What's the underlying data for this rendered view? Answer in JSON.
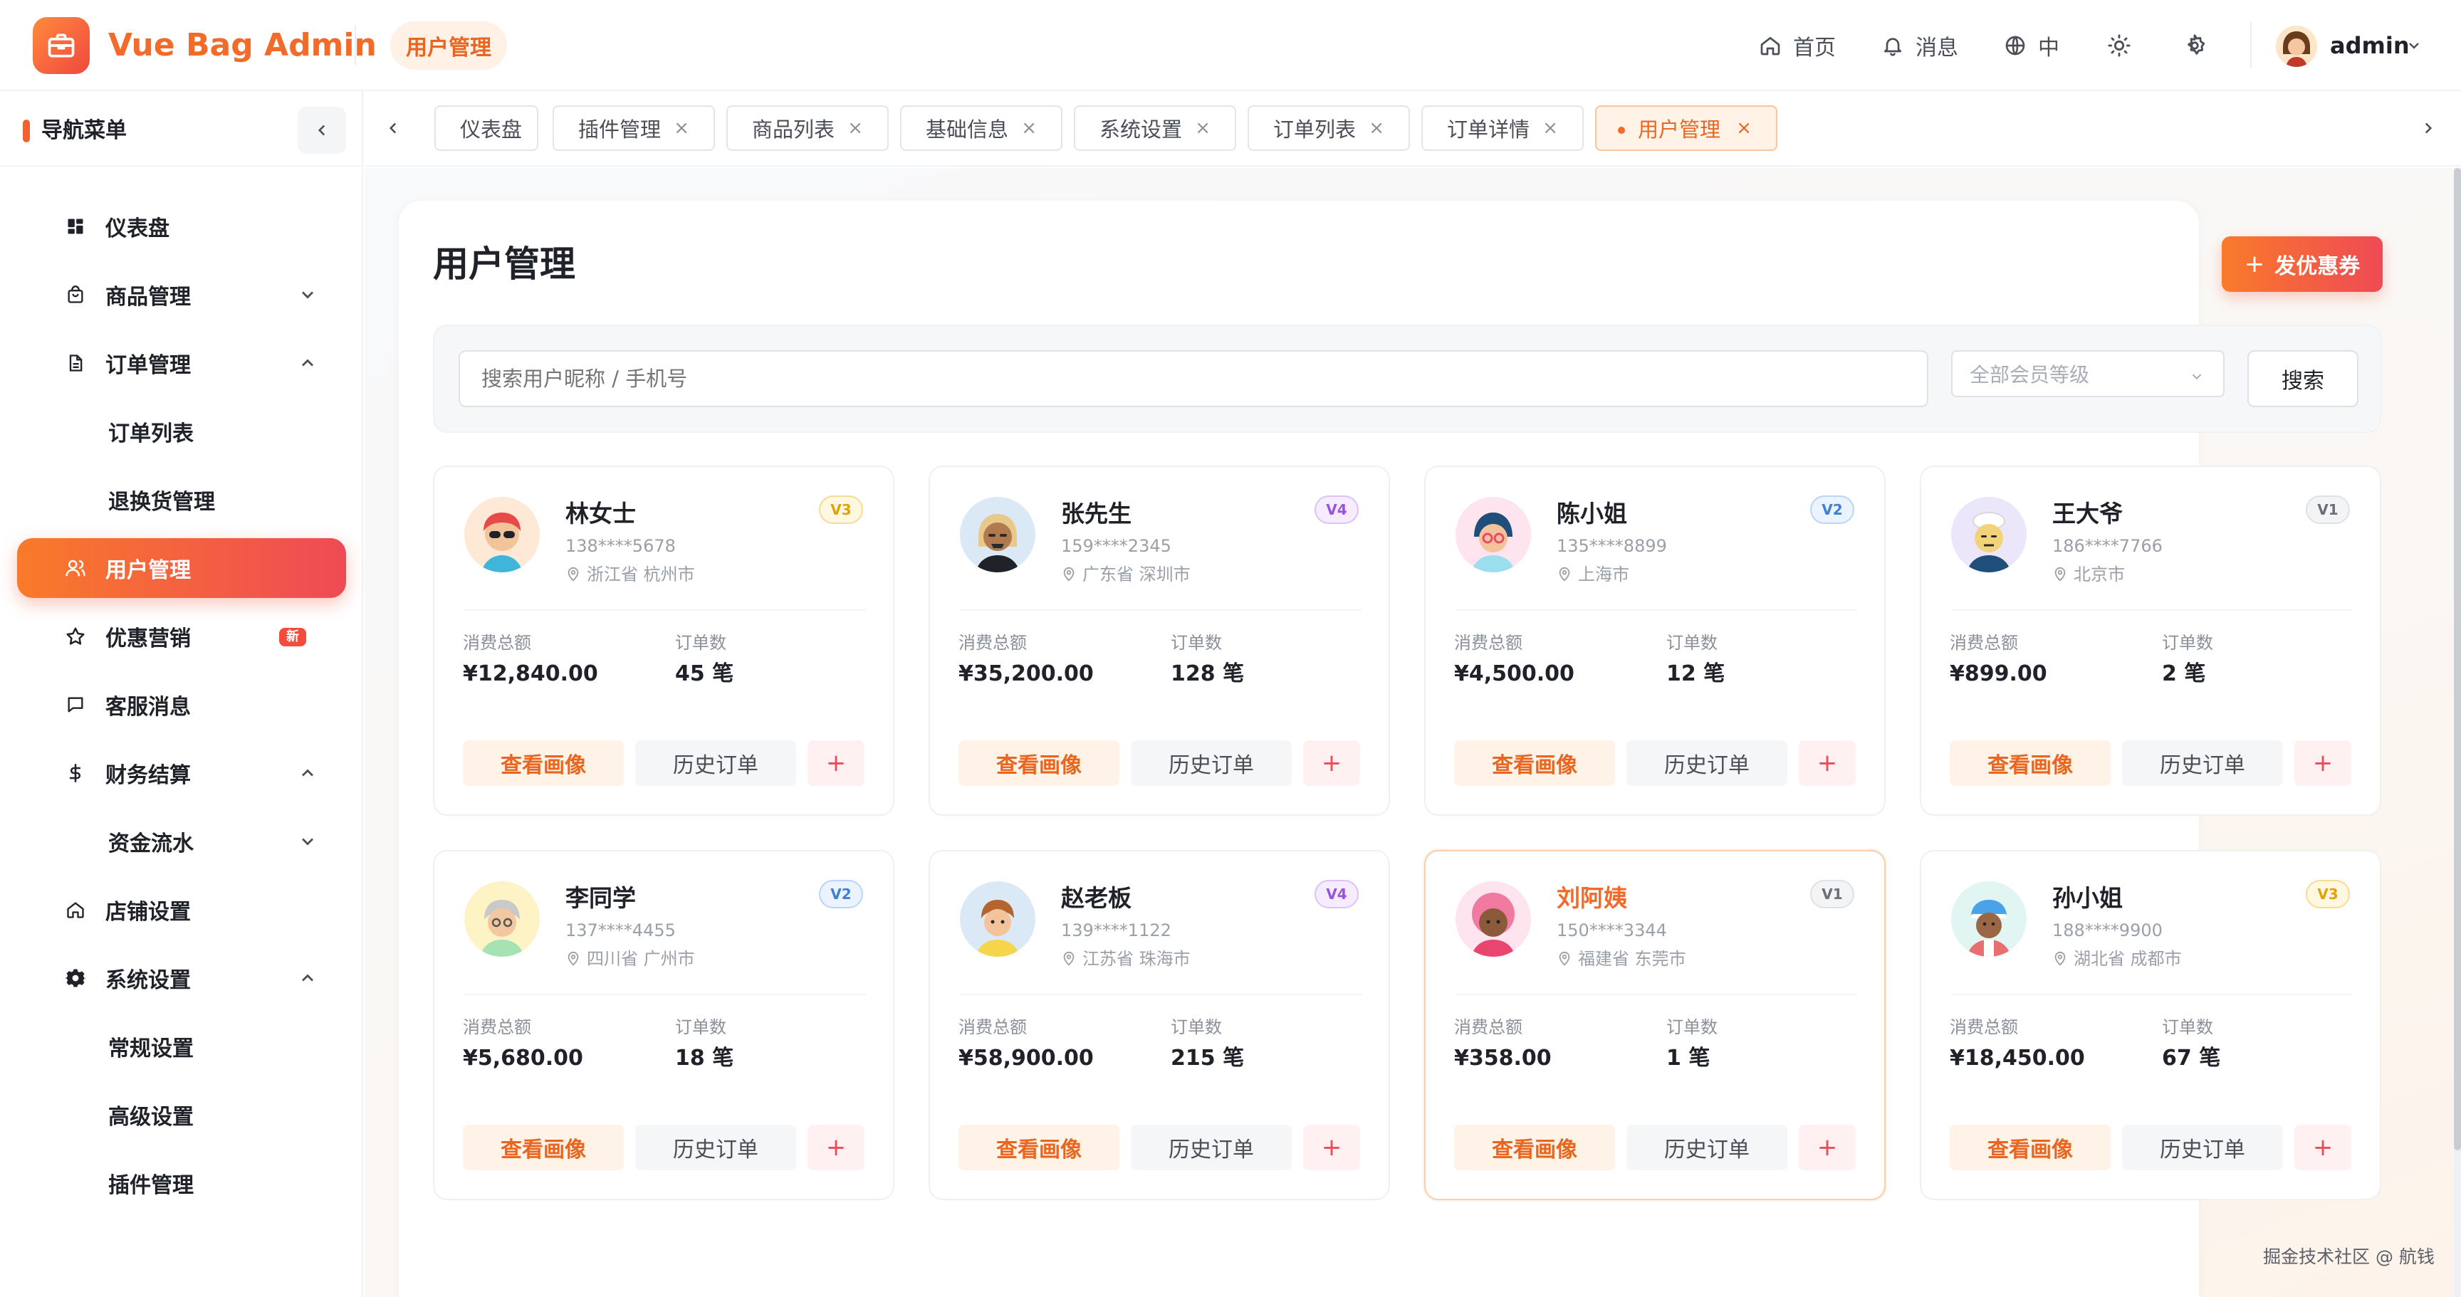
{
  "app": {
    "title": "Vue Bag Admin",
    "current_badge": "用户管理"
  },
  "header": {
    "nav": [
      {
        "label": "首页",
        "icon": "home-icon"
      },
      {
        "label": "消息",
        "icon": "bell-icon"
      },
      {
        "label": "中",
        "icon": "globe-icon"
      }
    ],
    "user": "admin"
  },
  "sidebar": {
    "title": "导航菜单",
    "items": [
      {
        "label": "仪表盘",
        "icon": "dashboard-icon"
      },
      {
        "label": "商品管理",
        "icon": "bag-icon",
        "state": "collapsed"
      },
      {
        "label": "订单管理",
        "icon": "document-icon",
        "state": "expanded"
      },
      {
        "label": "订单列表"
      },
      {
        "label": "退换货管理"
      },
      {
        "label": "用户管理",
        "icon": "users-icon",
        "active": true
      },
      {
        "label": "优惠营销",
        "icon": "star-icon",
        "badge": "新"
      },
      {
        "label": "客服消息",
        "icon": "chat-icon"
      },
      {
        "label": "财务结算",
        "icon": "dollar-icon",
        "state": "expanded"
      },
      {
        "label": "资金流水",
        "state": "collapsed"
      },
      {
        "label": "店铺设置",
        "icon": "home-icon"
      },
      {
        "label": "系统设置",
        "icon": "gear-icon",
        "state": "expanded"
      },
      {
        "label": "常规设置"
      },
      {
        "label": "高级设置"
      },
      {
        "label": "插件管理"
      }
    ]
  },
  "tabs": [
    {
      "label": "仪表盘",
      "closable": false
    },
    {
      "label": "插件管理",
      "closable": true
    },
    {
      "label": "商品列表",
      "closable": true
    },
    {
      "label": "基础信息",
      "closable": true
    },
    {
      "label": "系统设置",
      "closable": true
    },
    {
      "label": "订单列表",
      "closable": true
    },
    {
      "label": "订单详情",
      "closable": true
    },
    {
      "label": "用户管理",
      "closable": true,
      "active": true
    }
  ],
  "tab_close_glyph": "×",
  "page": {
    "title": "用户管理",
    "coupon_button": "发优惠券",
    "search_placeholder": "搜索用户昵称 / 手机号",
    "level_placeholder": "全部会员等级",
    "search_button": "搜索"
  },
  "card_labels": {
    "spend": "消费总额",
    "orders": "订单数",
    "view_profile": "查看画像",
    "history": "历史订单",
    "add": "+"
  },
  "users": [
    {
      "name": "林女士",
      "phone": "138****5678",
      "location": "浙江省 杭州市",
      "level": "V3",
      "spend": "¥12,840.00",
      "orders": "45 笔"
    },
    {
      "name": "张先生",
      "phone": "159****2345",
      "location": "广东省 深圳市",
      "level": "V4",
      "spend": "¥35,200.00",
      "orders": "128 笔"
    },
    {
      "name": "陈小姐",
      "phone": "135****8899",
      "location": "上海市",
      "level": "V2",
      "spend": "¥4,500.00",
      "orders": "12 笔"
    },
    {
      "name": "王大爷",
      "phone": "186****7766",
      "location": "北京市",
      "level": "V1",
      "spend": "¥899.00",
      "orders": "2 笔"
    },
    {
      "name": "李同学",
      "phone": "137****4455",
      "location": "四川省 广州市",
      "level": "V2",
      "spend": "¥5,680.00",
      "orders": "18 笔"
    },
    {
      "name": "赵老板",
      "phone": "139****1122",
      "location": "江苏省 珠海市",
      "level": "V4",
      "spend": "¥58,900.00",
      "orders": "215 笔"
    },
    {
      "name": "刘阿姨",
      "phone": "150****3344",
      "location": "福建省 东莞市",
      "level": "V1",
      "spend": "¥358.00",
      "orders": "1 笔",
      "highlighted": true
    },
    {
      "name": "孙小姐",
      "phone": "188****9900",
      "location": "湖北省 成都市",
      "level": "V3",
      "spend": "¥18,450.00",
      "orders": "67 笔"
    }
  ],
  "level_colors": {
    "V1": {
      "bg": "#f3f4f6",
      "fg": "#6b7078",
      "border": "#dfe1e6"
    },
    "V2": {
      "bg": "#eaf3ff",
      "fg": "#3b82d6",
      "border": "#b9d6f7"
    },
    "V3": {
      "bg": "#fff8e1",
      "fg": "#e5a00d",
      "border": "#f5dc93"
    },
    "V4": {
      "bg": "#f6ecff",
      "fg": "#9b51e0",
      "border": "#dcc2f5"
    }
  },
  "watermark": "掘金技术社区 @ 航钱",
  "colors": {
    "accent": "#f26b2a",
    "accent_end": "#ef4a55"
  }
}
